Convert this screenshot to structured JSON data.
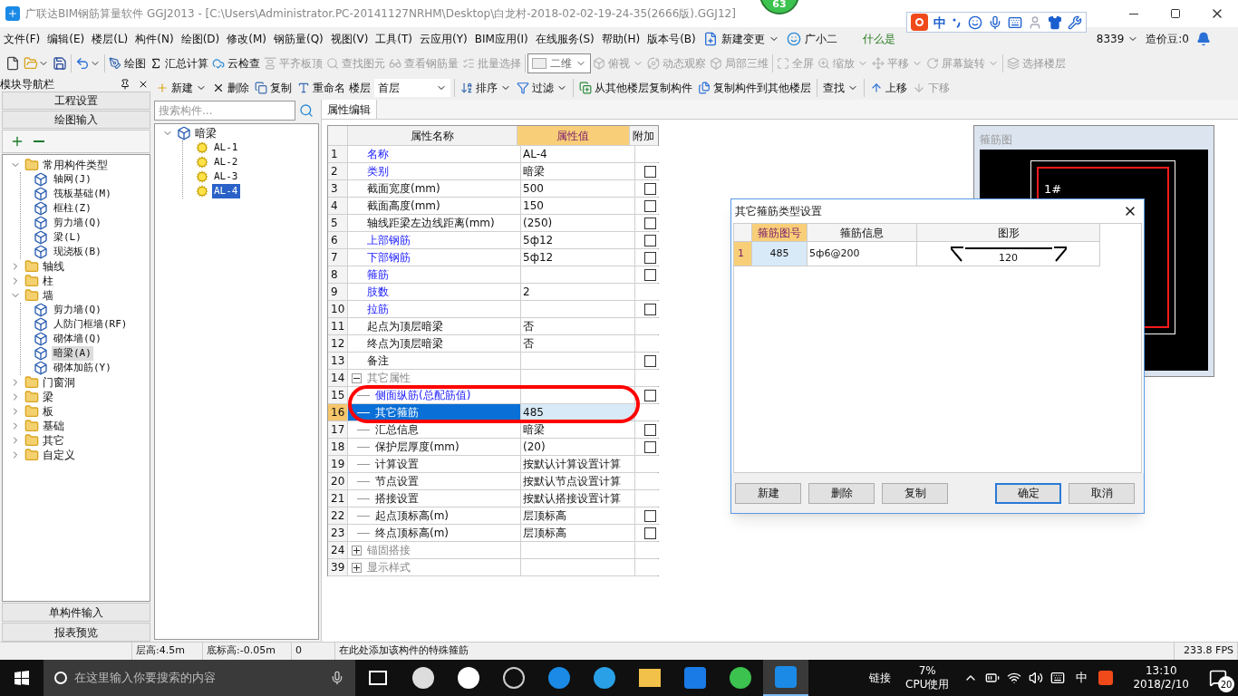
{
  "window": {
    "title": "广联达BIM钢筋算量软件 GGJ2013 - [C:\\Users\\Administrator.PC-20141127NRHM\\Desktop\\白龙村-2018-02-02-19-24-35(2666版).GGJ12]",
    "badge": "63"
  },
  "menu": [
    "文件(F)",
    "编辑(E)",
    "楼层(L)",
    "构件(N)",
    "绘图(D)",
    "修改(M)",
    "钢筋量(Q)",
    "视图(V)",
    "工具(T)",
    "云应用(Y)",
    "BIM应用(I)",
    "在线服务(S)",
    "帮助(H)",
    "版本号(B)"
  ],
  "menu_extra": {
    "new_change": "新建变更",
    "helper": "广小二",
    "hint": "什么是",
    "account": "8339",
    "beans": "造价豆:0"
  },
  "ime": {
    "mode": "中"
  },
  "toolbar": [
    {
      "kind": "icon",
      "dropdown": false
    },
    {
      "kind": "icon",
      "dropdown": true
    },
    {
      "kind": "icon",
      "dropdown": false
    },
    {
      "kind": "sep"
    },
    {
      "kind": "icon",
      "dropdown": true
    },
    {
      "kind": "sep"
    },
    {
      "kind": "button",
      "label": "绘图",
      "disabled": false,
      "dropdown": false
    },
    {
      "kind": "button",
      "label": "汇总计算",
      "disabled": false,
      "dropdown": false
    },
    {
      "kind": "button",
      "label": "云检查",
      "disabled": false,
      "dropdown": false
    },
    {
      "kind": "button",
      "label": "平齐板顶",
      "disabled": true,
      "dropdown": false
    },
    {
      "kind": "button",
      "label": "查找图元",
      "disabled": true,
      "dropdown": false
    },
    {
      "kind": "button",
      "label": "查看钢筋量",
      "disabled": true,
      "dropdown": false
    },
    {
      "kind": "button",
      "label": "批量选择",
      "disabled": true,
      "dropdown": false
    },
    {
      "kind": "sep"
    },
    {
      "kind": "select",
      "label": "二维"
    },
    {
      "kind": "button",
      "label": "俯视",
      "disabled": true,
      "dropdown": true
    },
    {
      "kind": "button",
      "label": "动态观察",
      "disabled": true,
      "dropdown": false
    },
    {
      "kind": "button",
      "label": "局部三维",
      "disabled": true,
      "dropdown": false
    },
    {
      "kind": "sep"
    },
    {
      "kind": "button",
      "label": "全屏",
      "disabled": true,
      "dropdown": false
    },
    {
      "kind": "button",
      "label": "缩放",
      "disabled": true,
      "dropdown": true
    },
    {
      "kind": "button",
      "label": "平移",
      "disabled": true,
      "dropdown": true
    },
    {
      "kind": "button",
      "label": "屏幕旋转",
      "disabled": true,
      "dropdown": true
    },
    {
      "kind": "sep"
    },
    {
      "kind": "button",
      "label": "选择楼层",
      "disabled": true,
      "dropdown": false
    }
  ],
  "nav": {
    "title": "模块导航栏",
    "top_sections": [
      "工程设置",
      "绘图输入"
    ],
    "tree": [
      {
        "label": "常用构件类型",
        "kind": "folder",
        "expanded": true,
        "children": [
          {
            "label": "轴网(J)",
            "kind": "item",
            "selected": false
          },
          {
            "label": "筏板基础(M)",
            "kind": "item",
            "selected": false
          },
          {
            "label": "框柱(Z)",
            "kind": "item",
            "selected": false
          },
          {
            "label": "剪力墙(Q)",
            "kind": "item",
            "selected": false
          },
          {
            "label": "梁(L)",
            "kind": "item",
            "selected": false
          },
          {
            "label": "现浇板(B)",
            "kind": "item",
            "selected": false
          }
        ]
      },
      {
        "label": "轴线",
        "kind": "folder",
        "expanded": false
      },
      {
        "label": "柱",
        "kind": "folder",
        "expanded": false
      },
      {
        "label": "墙",
        "kind": "folder",
        "expanded": true,
        "children": [
          {
            "label": "剪力墙(Q)",
            "kind": "item",
            "selected": false
          },
          {
            "label": "人防门框墙(RF)",
            "kind": "item",
            "selected": false
          },
          {
            "label": "砌体墙(Q)",
            "kind": "item",
            "selected": false
          },
          {
            "label": "暗梁(A)",
            "kind": "item",
            "selected": true
          },
          {
            "label": "砌体加筋(Y)",
            "kind": "item",
            "selected": false
          }
        ]
      },
      {
        "label": "门窗洞",
        "kind": "folder",
        "expanded": false
      },
      {
        "label": "梁",
        "kind": "folder",
        "expanded": false
      },
      {
        "label": "板",
        "kind": "folder",
        "expanded": false
      },
      {
        "label": "基础",
        "kind": "folder",
        "expanded": false
      },
      {
        "label": "其它",
        "kind": "folder",
        "expanded": false
      },
      {
        "label": "自定义",
        "kind": "folder",
        "expanded": false
      }
    ],
    "bottom_sections": [
      "单构件输入",
      "报表预览"
    ]
  },
  "toolbar2": [
    {
      "kind": "button",
      "label": "新建",
      "dropdown": true,
      "disabled": false
    },
    {
      "kind": "button",
      "label": "删除",
      "dropdown": false,
      "disabled": false
    },
    {
      "kind": "button",
      "label": "复制",
      "dropdown": false,
      "disabled": false
    },
    {
      "kind": "button",
      "label": "重命名",
      "dropdown": false,
      "disabled": false
    },
    {
      "kind": "floor",
      "label": "楼层",
      "value": "首层"
    },
    {
      "kind": "sep"
    },
    {
      "kind": "button",
      "label": "排序",
      "dropdown": true,
      "disabled": false
    },
    {
      "kind": "button",
      "label": "过滤",
      "dropdown": true,
      "disabled": false
    },
    {
      "kind": "sep"
    },
    {
      "kind": "button",
      "label": "从其他楼层复制构件",
      "dropdown": false,
      "disabled": false
    },
    {
      "kind": "button",
      "label": "复制构件到其他楼层",
      "dropdown": false,
      "disabled": false
    },
    {
      "kind": "sep"
    },
    {
      "kind": "button",
      "label": "查找",
      "dropdown": true,
      "disabled": false
    },
    {
      "kind": "sep"
    },
    {
      "kind": "button",
      "label": "上移",
      "dropdown": false,
      "disabled": false
    },
    {
      "kind": "button",
      "label": "下移",
      "dropdown": false,
      "disabled": true
    }
  ],
  "search": {
    "placeholder": "搜索构件..."
  },
  "component_tree": {
    "label": "暗梁",
    "expanded": true,
    "children": [
      {
        "label": "AL-1",
        "selected": false
      },
      {
        "label": "AL-2",
        "selected": false
      },
      {
        "label": "AL-3",
        "selected": false
      },
      {
        "label": "AL-4",
        "selected": true
      }
    ]
  },
  "properties": {
    "tab": "属性编辑",
    "columns": [
      "属性名称",
      "属性值",
      "附加"
    ],
    "rows": [
      {
        "num": "1",
        "name": "名称",
        "value": "AL-4",
        "kind": "link",
        "selected": false
      },
      {
        "num": "2",
        "name": "类别",
        "value": "暗梁",
        "kind": "link",
        "attach": false,
        "selected": false
      },
      {
        "num": "3",
        "name": "截面宽度(mm)",
        "value": "500",
        "kind": "plain",
        "attach": false,
        "selected": false
      },
      {
        "num": "4",
        "name": "截面高度(mm)",
        "value": "150",
        "kind": "plain",
        "attach": false,
        "selected": false
      },
      {
        "num": "5",
        "name": "轴线距梁左边线距离(mm)",
        "value": "(250)",
        "kind": "plain",
        "attach": false,
        "selected": false
      },
      {
        "num": "6",
        "name": "上部钢筋",
        "value": "5ф12",
        "kind": "link",
        "attach": false,
        "selected": false
      },
      {
        "num": "7",
        "name": "下部钢筋",
        "value": "5ф12",
        "kind": "link",
        "attach": false,
        "selected": false
      },
      {
        "num": "8",
        "name": "箍筋",
        "kind": "link",
        "attach": false,
        "selected": false
      },
      {
        "num": "9",
        "name": "肢数",
        "value": "2",
        "kind": "link",
        "selected": false
      },
      {
        "num": "10",
        "name": "拉筋",
        "kind": "link",
        "attach": false,
        "selected": false
      },
      {
        "num": "11",
        "name": "起点为顶层暗梁",
        "value": "否",
        "kind": "plain",
        "selected": false
      },
      {
        "num": "12",
        "name": "终点为顶层暗梁",
        "value": "否",
        "kind": "plain",
        "selected": false
      },
      {
        "num": "13",
        "name": "备注",
        "kind": "plain",
        "attach": false,
        "selected": false
      },
      {
        "num": "14",
        "name": "其它属性",
        "kind": "group",
        "expanded": true,
        "selected": false
      },
      {
        "num": "15",
        "name": "侧面纵筋(总配筋值)",
        "kind": "child-link",
        "attach": false,
        "selected": false
      },
      {
        "num": "16",
        "name": "其它箍筋",
        "value": "485",
        "kind": "child",
        "selected": true
      },
      {
        "num": "17",
        "name": "汇总信息",
        "value": "暗梁",
        "kind": "child",
        "attach": false,
        "selected": false
      },
      {
        "num": "18",
        "name": "保护层厚度(mm)",
        "value": "(20)",
        "kind": "child",
        "attach": false,
        "selected": false
      },
      {
        "num": "19",
        "name": "计算设置",
        "value": "按默认计算设置计算",
        "kind": "child",
        "selected": false
      },
      {
        "num": "20",
        "name": "节点设置",
        "value": "按默认节点设置计算",
        "kind": "child",
        "selected": false
      },
      {
        "num": "21",
        "name": "搭接设置",
        "value": "按默认搭接设置计算",
        "kind": "child",
        "selected": false
      },
      {
        "num": "22",
        "name": "起点顶标高(m)",
        "value": "层顶标高",
        "kind": "child",
        "attach": false,
        "selected": false
      },
      {
        "num": "23",
        "name": "终点顶标高(m)",
        "value": "层顶标高",
        "kind": "child",
        "attach": false,
        "selected": false
      },
      {
        "num": "24",
        "name": "锚固搭接",
        "kind": "group",
        "expanded": false,
        "selected": false
      },
      {
        "num": "39",
        "name": "显示样式",
        "kind": "group",
        "expanded": false,
        "selected": false
      }
    ]
  },
  "stirrup_panel": {
    "title": "箍筋图",
    "label": "1#"
  },
  "dialog": {
    "title": "其它箍筋类型设置",
    "columns": [
      "箍筋图号",
      "箍筋信息",
      "图形"
    ],
    "rows": [
      {
        "num": "1",
        "code": "485",
        "info": "5ф6@200",
        "shape_value": "120",
        "selected": true
      }
    ],
    "buttons": [
      {
        "label": "新建",
        "default": false
      },
      {
        "label": "删除",
        "default": false
      },
      {
        "label": "复制",
        "default": false
      },
      {
        "label": "确定",
        "default": true
      },
      {
        "label": "取消",
        "default": false
      }
    ]
  },
  "status_bar": [
    "层高:4.5m",
    "底标高:-0.05m",
    "0",
    "在此处添加该构件的特殊箍筋",
    "233.8 FPS"
  ],
  "taskbar": {
    "search_placeholder": "在这里输入你要搜索的内容",
    "links": "链接",
    "cpu": "7%",
    "cpu_label": "CPU使用",
    "ime": "中",
    "time": "13:10",
    "date": "2018/2/10",
    "notifications": "20"
  }
}
